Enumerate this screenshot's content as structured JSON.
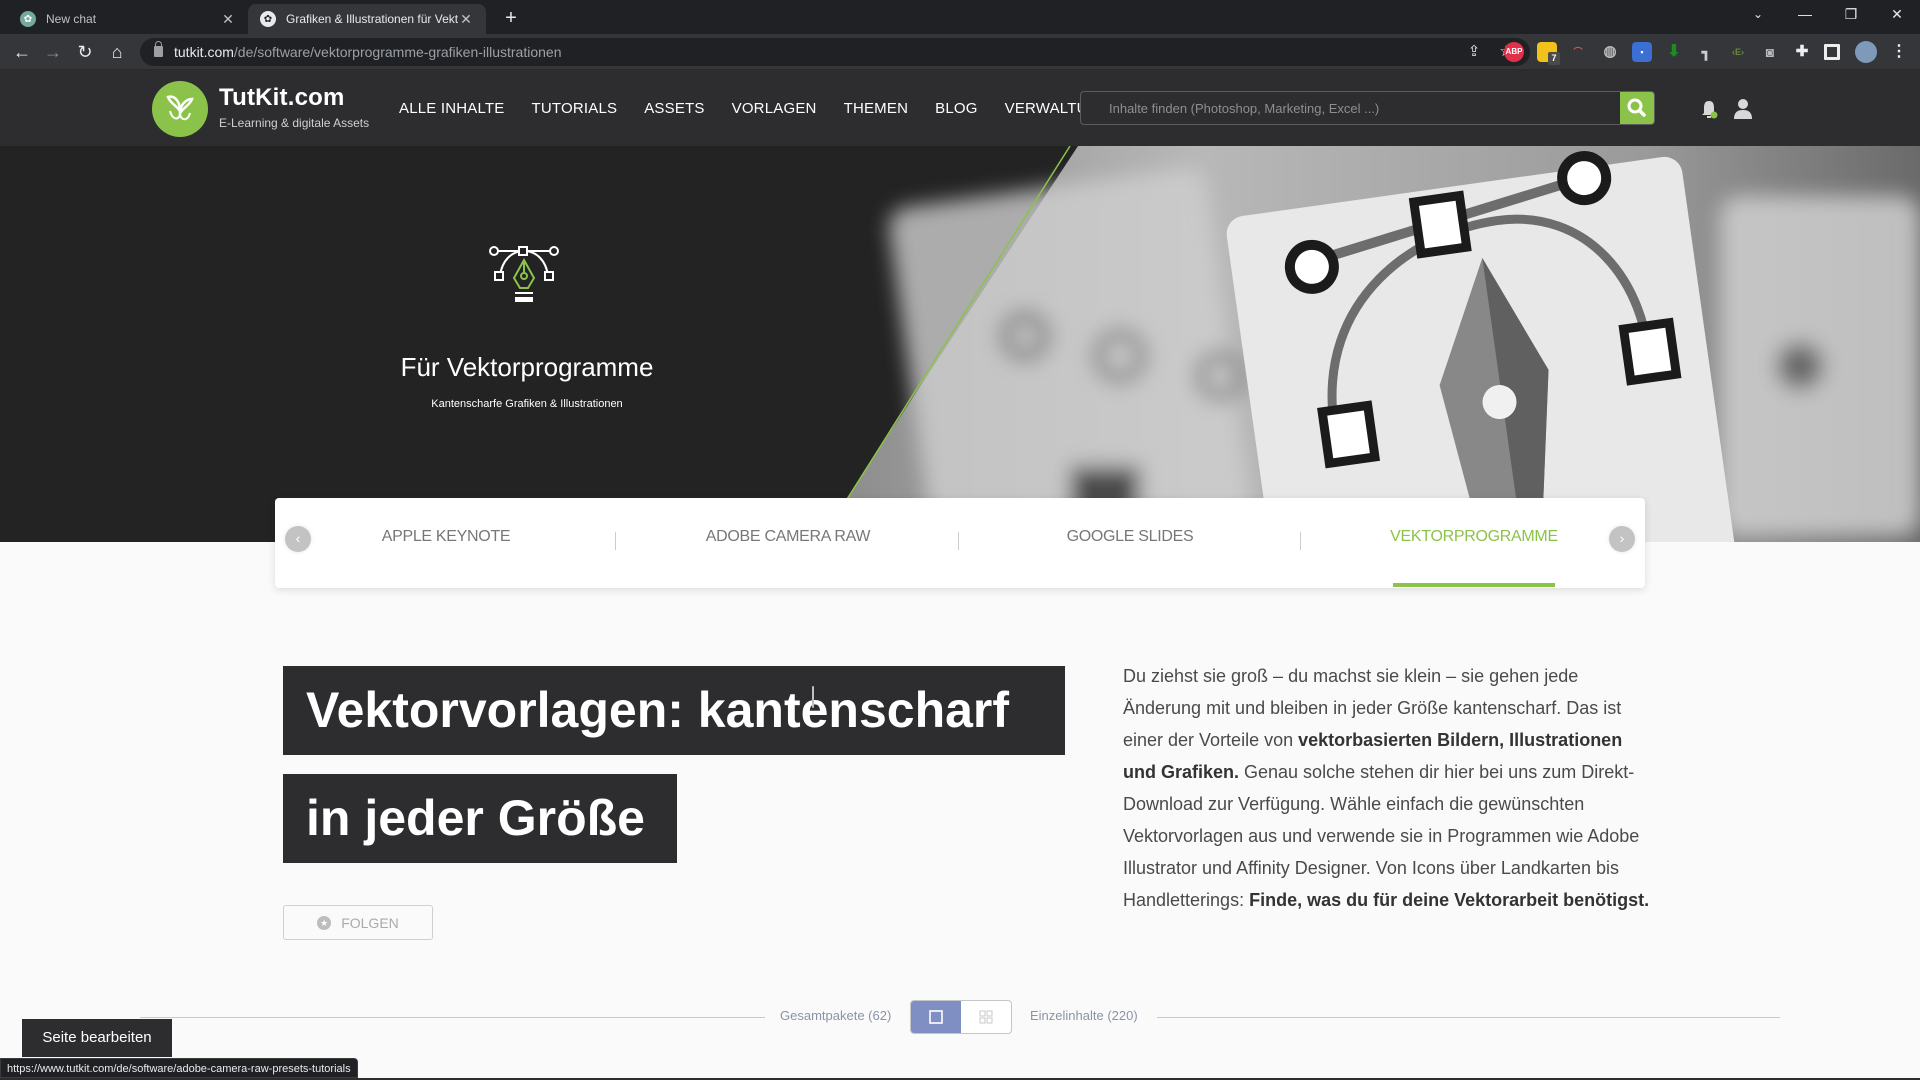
{
  "browser": {
    "tabs": [
      {
        "title": "New chat",
        "favicon": "chatgpt-icon",
        "active": false
      },
      {
        "title": "Grafiken & Illustrationen für Vekt",
        "favicon": "tutkit-icon",
        "active": true
      }
    ],
    "new_tab_label": "+",
    "url_host": "tutkit.com",
    "url_path": "/de/software/vektorprogramme-grafiken-illustrationen",
    "extensions": [
      "share-icon",
      "bookmark-star-icon",
      "adblock-plus-icon",
      "notes-extension-icon",
      "rainbow-extension-icon",
      "globe-extension-icon",
      "tag-extension-icon",
      "download-arrow-icon",
      "tool-extension-icon",
      "code-extension-icon",
      "camera-icon",
      "extensions-puzzle-icon",
      "side-panel-icon",
      "profile-avatar",
      "menu-kebab-icon"
    ],
    "extension_badge": "7",
    "adblock_label": "ABP",
    "status_url": "https://www.tutkit.com/de/software/adobe-camera-raw-presets-tutorials"
  },
  "site": {
    "brand": "TutKit.com",
    "tagline": "E-Learning & digitale Assets",
    "nav": [
      "ALLE INHALTE",
      "TUTORIALS",
      "ASSETS",
      "VORLAGEN",
      "THEMEN",
      "BLOG",
      "VERWALTUNG"
    ],
    "search_placeholder": "Inhalte finden (Photoshop, Marketing, Excel ...)",
    "accent_color": "#8bc34a"
  },
  "hero": {
    "title": "Für Vektorprogramme",
    "subtitle": "Kantenscharfe Grafiken & Illustrationen",
    "icon": "vector-pen-icon"
  },
  "category_tabs": {
    "items": [
      "APPLE KEYNOTE",
      "ADOBE CAMERA RAW",
      "GOOGLE SLIDES",
      "VEKTORPROGRAMME"
    ],
    "active": "VEKTORPROGRAMME",
    "prev_label": "‹",
    "next_label": "›"
  },
  "main": {
    "headline_line1": "Vektorvorlagen: kantenscharf",
    "headline_line2": "in jeder Größe",
    "follow_label": "FOLGEN",
    "description": {
      "p1": "Du ziehst sie groß – du machst sie klein – sie gehen jede Änderung mit und bleiben in jeder Größe kantenscharf. Das ist einer der Vorteile von ",
      "b1": "vektorbasierten Bildern, Illustrationen und Grafiken.",
      "p2": " Genau solche stehen dir hier bei uns zum Direkt-Download zur Verfügung. Wähle einfach die gewünschten Vektorvorlagen aus und verwende sie in Programmen wie Adobe Illustrator und Affinity Designer. Von Icons über Landkarten bis Handletterings: ",
      "b2": "Finde, was du für deine Vektorarbeit benötigst."
    }
  },
  "switcher": {
    "left_label": "Gesamtpakete (62)",
    "right_label": "Einzelinhalte (220)",
    "selected": "single-view"
  },
  "edit_page_label": "Seite bearbeiten"
}
